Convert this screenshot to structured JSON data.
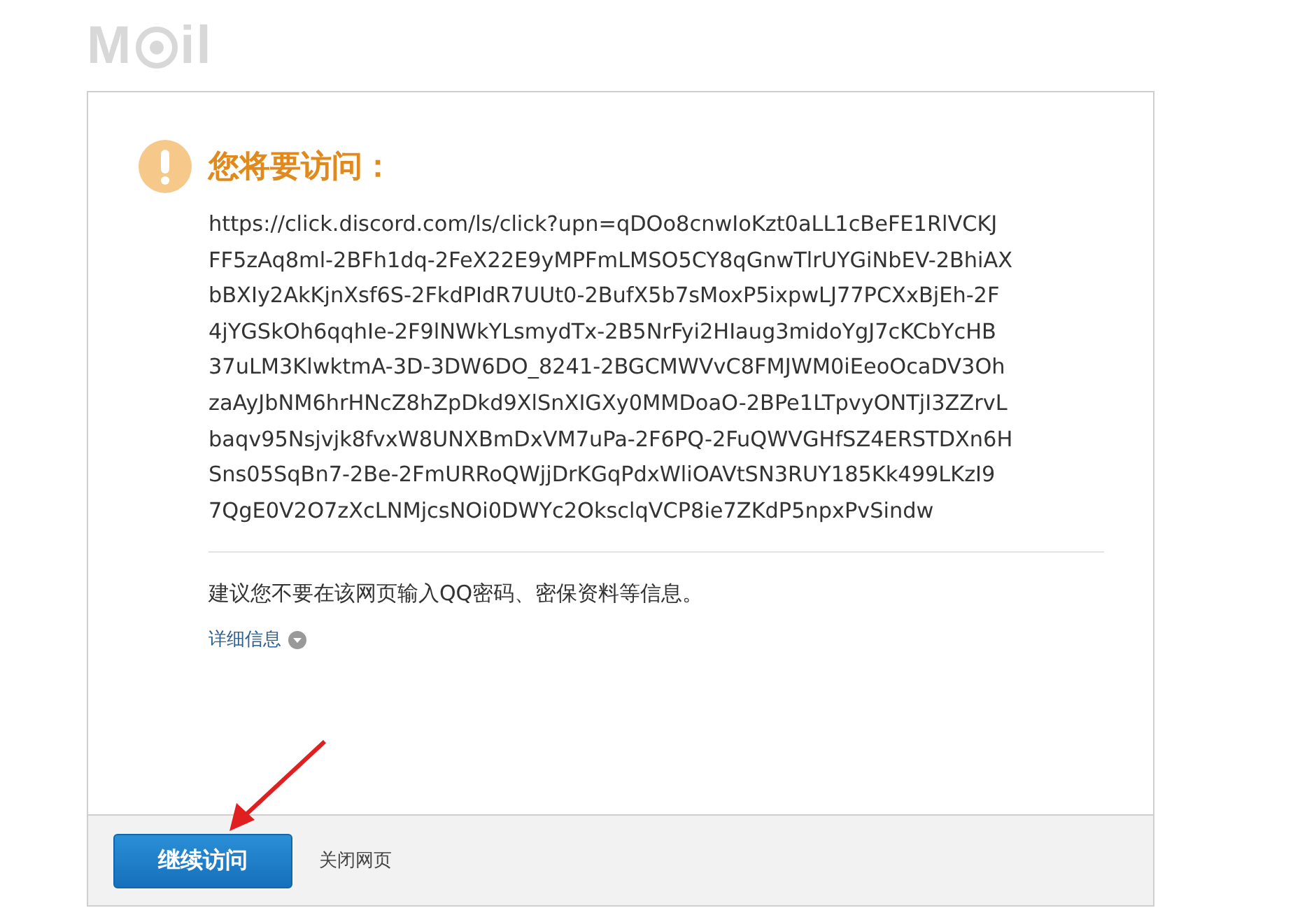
{
  "logo": {
    "before": "M",
    "after": "il"
  },
  "title": "您将要访问：",
  "url_lines": [
    "https://click.discord.com/ls/click?upn=qDOo8cnwIoKzt0aLL1cBeFE1RlVCKJ",
    "FF5zAq8ml-2BFh1dq-2FeX22E9yMPFmLMSO5CY8qGnwTlrUYGiNbEV-2BhiAX",
    "bBXIy2AkKjnXsf6S-2FkdPIdR7UUt0-2BufX5b7sMoxP5ixpwLJ77PCXxBjEh-2F",
    "4jYGSkOh6qqhIe-2F9lNWkYLsmydTx-2B5NrFyi2HIaug3midoYgJ7cKCbYcHB",
    "37uLM3KlwktmA-3D-3DW6DO_8241-2BGCMWVvC8FMJWM0iEeoOcaDV3Oh",
    "zaAyJbNM6hrHNcZ8hZpDkd9XlSnXIGXy0MMDoaO-2BPe1LTpvyONTjI3ZZrvL",
    "baqv95Nsjvjk8fvxW8UNXBmDxVM7uPa-2F6PQ-2FuQWVGHfSZ4ERSTDXn6H",
    "Sns05SqBn7-2Be-2FmURRoQWjjDrKGqPdxWliOAVtSN3RUY185Kk499LKzI9",
    "7QgE0V2O7zXcLNMjcsNOi0DWYc2OksclqVCP8ie7ZKdP5npxPvSindw"
  ],
  "warning": "建议您不要在该网页输入QQ密码、密保资料等信息。",
  "details": {
    "label": "详细信息",
    "expanded": false
  },
  "buttons": [
    {
      "kind": "primary",
      "label": "继续访问"
    },
    {
      "kind": "link",
      "label": "关闭网页"
    }
  ]
}
